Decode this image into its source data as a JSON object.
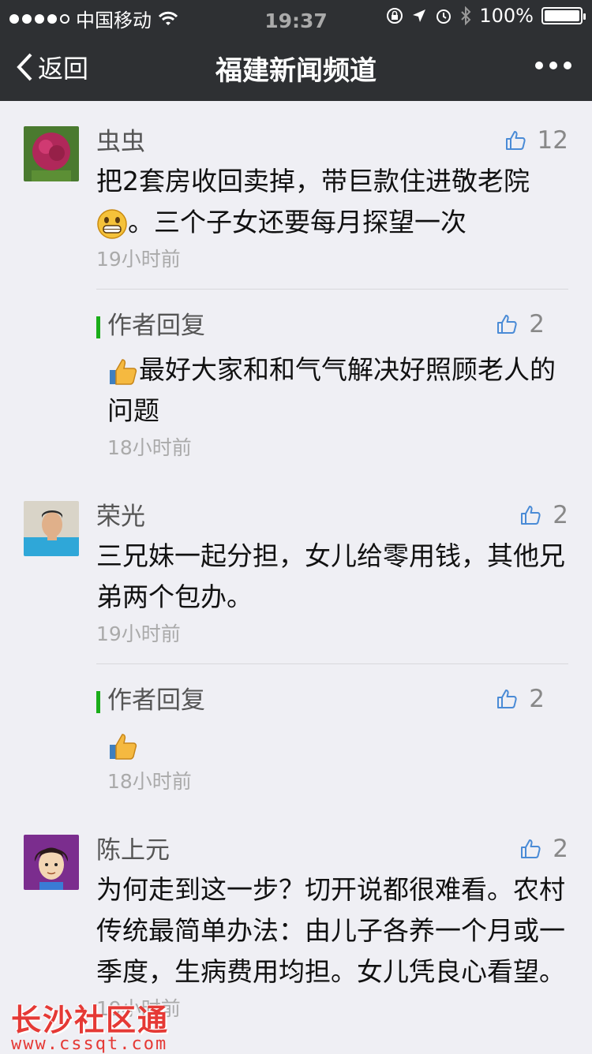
{
  "status": {
    "carrier": "中国移动",
    "time": "19:37",
    "battery": "100%"
  },
  "nav": {
    "back_label": "返回",
    "title": "福建新闻频道"
  },
  "comments": [
    {
      "name": "虫虫",
      "likes": "12",
      "text_a": "把2套房收回卖掉，带巨款住进敬老院",
      "text_b": "。三个子女还要每月探望一次",
      "time": "19小时前",
      "reply": {
        "name": "作者回复",
        "likes": "2",
        "text": "最好大家和和气气解决好照顾老人的问题",
        "time": "18小时前"
      }
    },
    {
      "name": "荣光",
      "likes": "2",
      "text": "三兄妹一起分担，女儿给零用钱，其他兄弟两个包办。",
      "time": "19小时前",
      "reply": {
        "name": "作者回复",
        "likes": "2",
        "text": "",
        "time": "18小时前"
      }
    },
    {
      "name": "陈上元",
      "likes": "2",
      "text": "为何走到这一步？切开说都很难看。农村传统最简单办法：由儿子各养一个月或一季度，生病费用均担。女儿凭良心看望。",
      "time": "19小时前"
    }
  ],
  "watermark": {
    "line1": "长沙社区通",
    "line2": "www.cssqt.com"
  }
}
